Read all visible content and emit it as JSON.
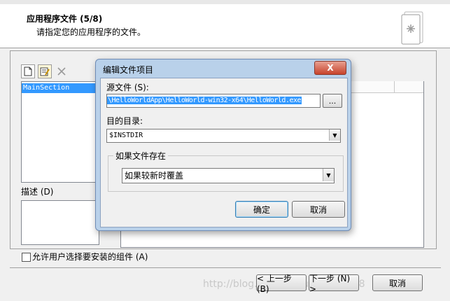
{
  "header": {
    "title": "应用程序文件 (5/8)",
    "subtitle": "请指定您的应用程序的文件。"
  },
  "toolbar": {
    "new_icon": "new-file-icon",
    "edit_icon": "edit-icon",
    "delete_icon": "delete-x-icon"
  },
  "sections": {
    "items": [
      "MainSection"
    ]
  },
  "description": {
    "label": "描述 (D)"
  },
  "allow_select": {
    "label": "允许用户选择要安装的组件 (A)",
    "checked": false
  },
  "wizard_buttons": {
    "back": "< 上一步 (B)",
    "next": "下一步 (N) >",
    "cancel": "取消"
  },
  "watermark": "http://blog.csdn.net/u011735148",
  "dialog": {
    "title": "编辑文件项目",
    "close_glyph": "X",
    "source": {
      "label": "源文件 (S):",
      "value": "\\HelloWorldApp\\HelloWorld-win32-x64\\HelloWorld.exe",
      "browse_label": "..."
    },
    "destination": {
      "label": "目的目录:",
      "value": "$INSTDIR"
    },
    "if_exists": {
      "group_label": "如果文件存在",
      "value": "如果较新时覆盖"
    },
    "ok_label": "确定",
    "cancel_label": "取消"
  },
  "colors": {
    "selection": "#3399ff",
    "dialog_frame": "#b9d1ea",
    "close_button": "#c7432c"
  }
}
